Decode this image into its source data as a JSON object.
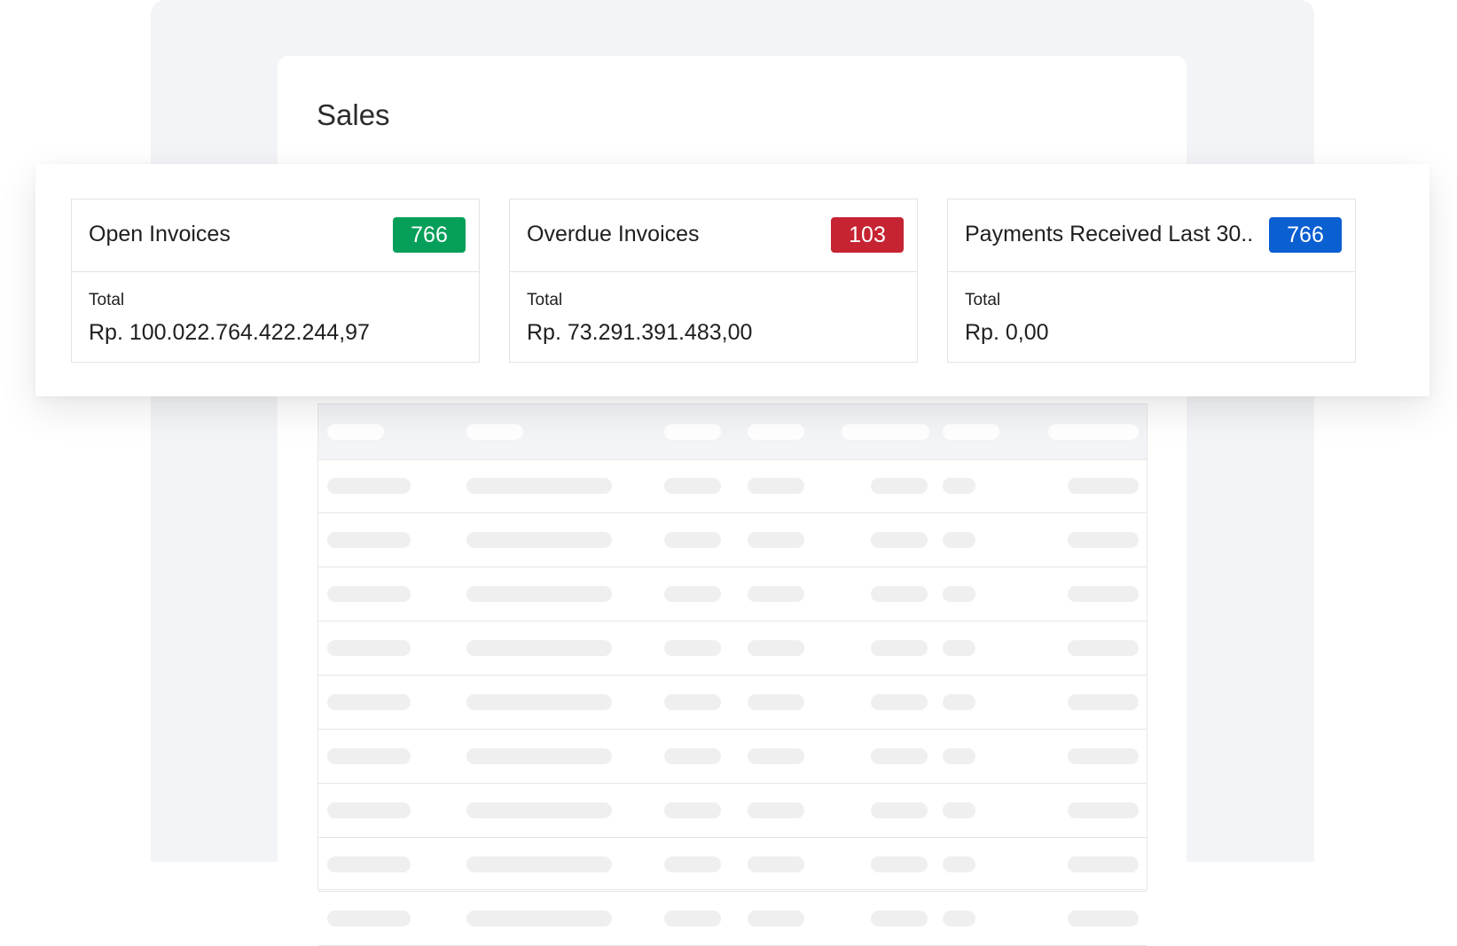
{
  "page": {
    "title": "Sales"
  },
  "colors": {
    "open_badge": "#069f5a",
    "overdue_badge": "#c62433",
    "payments_badge": "#0a5fd1",
    "backdrop": "#f3f4f7",
    "skeleton": "#efefef"
  },
  "cards": [
    {
      "title": "Open Invoices",
      "badge": "766",
      "total_label": "Total",
      "total_value": "Rp. 100.022.764.422.244,97"
    },
    {
      "title": "Overdue Invoices",
      "badge": "103",
      "total_label": "Total",
      "total_value": "Rp. 73.291.391.483,00"
    },
    {
      "title": "Payments Received Last 30..",
      "badge": "766",
      "total_label": "Total",
      "total_value": "Rp. 0,00"
    }
  ]
}
